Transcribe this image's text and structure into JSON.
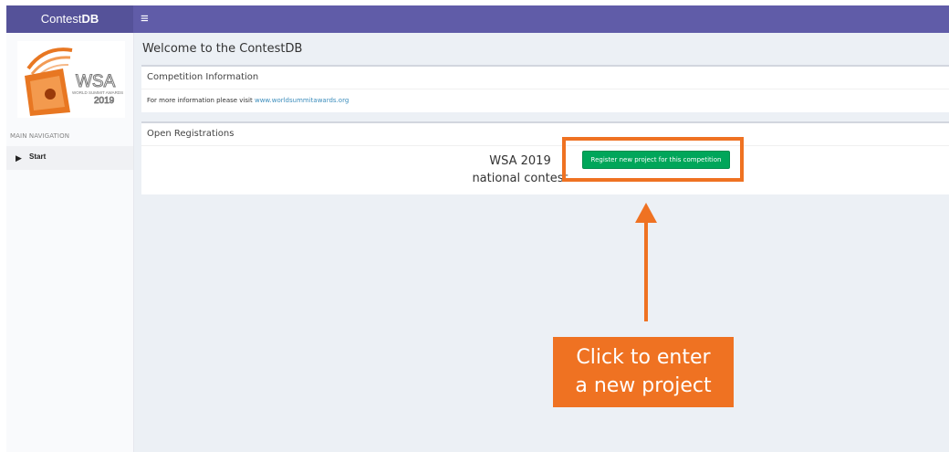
{
  "app": {
    "brand_prefix": "Contest",
    "brand_suffix": "DB",
    "menu_icon": "hamburger-icon"
  },
  "sidebar": {
    "logo": {
      "icon": "wsa-logo",
      "text_main": "WSA",
      "text_sub": "WORLD SUMMIT AWARDS",
      "text_year": "2019"
    },
    "nav_header": "MAIN NAVIGATION",
    "items": [
      {
        "label": "Start",
        "icon": "triangle-right-icon"
      }
    ]
  },
  "main": {
    "title": "Welcome to the ContestDB",
    "competition_info": {
      "heading": "Competition Information",
      "text": "For more information please visit ",
      "link": "www.worldsummitawards.org"
    },
    "open_registrations": {
      "heading": "Open Registrations",
      "contest_name": "WSA 2019 national contest",
      "register_button": "Register new project for this competition"
    }
  },
  "annotation": {
    "callout_line1": "Click to enter",
    "callout_line2": "a new project",
    "color": "#ef7222"
  },
  "colors": {
    "topbar": "#605ca8",
    "brand_bg": "#555299",
    "button": "#00a65a",
    "link": "#3c8dbc"
  }
}
